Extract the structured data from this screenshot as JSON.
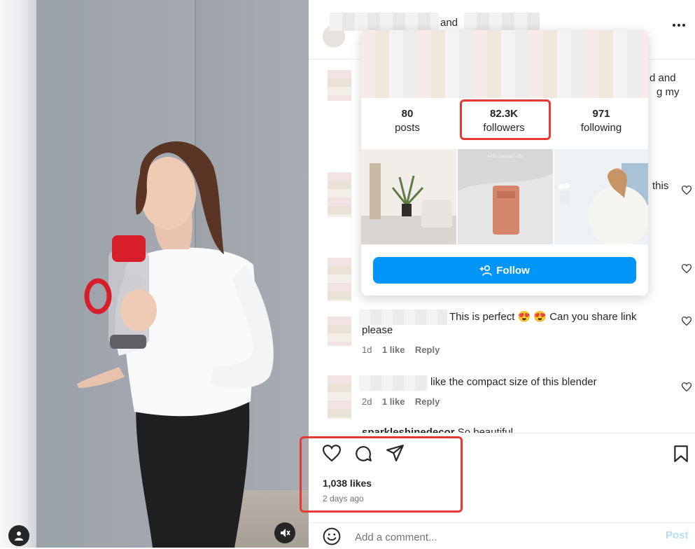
{
  "header": {
    "text": "and",
    "more_icon": "more-horizontal-icon"
  },
  "comments": [
    {
      "partial_text": "d and",
      "partial_text_2": "g my"
    },
    {
      "partial_text": "this"
    },
    {
      "text": "This is perfect 😍 😍 Can you share link",
      "text_2": "please",
      "age": "1d",
      "likes": "1 like",
      "reply": "Reply"
    },
    {
      "text": "like the compact size of this blender",
      "age": "2d",
      "likes": "1 like",
      "reply": "Reply"
    },
    {
      "author_cut": "sparkleshinedecor",
      "text": "So beautiful"
    }
  ],
  "profile_card": {
    "stats": [
      {
        "value": "80",
        "label": "posts"
      },
      {
        "value": "82.3K",
        "label": "followers"
      },
      {
        "value": "971",
        "label": "following"
      }
    ],
    "thumb_caption": "with essential oils",
    "follow_label": "Follow",
    "follow_icon": "add-person-icon"
  },
  "actions": {
    "likes": "1,038 likes",
    "posted": "2 days ago",
    "icons": [
      "heart-icon",
      "comment-icon",
      "share-icon",
      "bookmark-icon"
    ]
  },
  "comment_box": {
    "placeholder": "Add a comment...",
    "post_label": "Post"
  },
  "colors": {
    "accent": "#0095f6",
    "highlight": "#e53935",
    "muted": "#737373",
    "text": "#262626"
  }
}
